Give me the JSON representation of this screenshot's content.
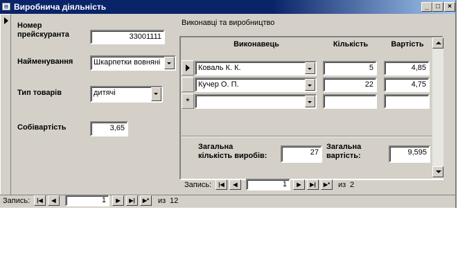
{
  "window": {
    "title": "Виробнича діяльність",
    "minimize": "_",
    "maximize": "□",
    "close": "×"
  },
  "fields": {
    "price_number_label": "Номер прейскуранта",
    "price_number_label_l1": "Номер",
    "price_number_label_l2": "прейскуранта",
    "price_number": "33001111",
    "name_label": "Найменування",
    "name_value": "Шкарпетки вовняні",
    "type_label": "Тип товарів",
    "type_value": "дитячі",
    "cost_label": "Собівартість",
    "cost_value": "3,65"
  },
  "subform": {
    "title": "Виконавці та виробництво",
    "columns": [
      "Виконавець",
      "Кількість",
      "Вартість"
    ],
    "rows": [
      {
        "performer": "Коваль К. К.",
        "qty": "5",
        "cost": "4,85"
      },
      {
        "performer": "Кучер О. П.",
        "qty": "22",
        "cost": "4,75"
      }
    ],
    "new_row_marker": "*",
    "total_qty_label_l1": "Загальна",
    "total_qty_label_l2": "кількість виробів:",
    "total_qty": "27",
    "total_cost_label_l1": "Загальна",
    "total_cost_label_l2": "вартість:",
    "total_cost": "9,595",
    "nav": {
      "label": "Запись:",
      "current": "1",
      "of": "из",
      "total": "2"
    }
  },
  "main_nav": {
    "label": "Запись:",
    "current": "1",
    "of": "из",
    "total": "12"
  },
  "nav_glyphs": {
    "first": "|◀",
    "prev": "◀",
    "next": "▶",
    "last": "▶|",
    "new": "▶*"
  }
}
